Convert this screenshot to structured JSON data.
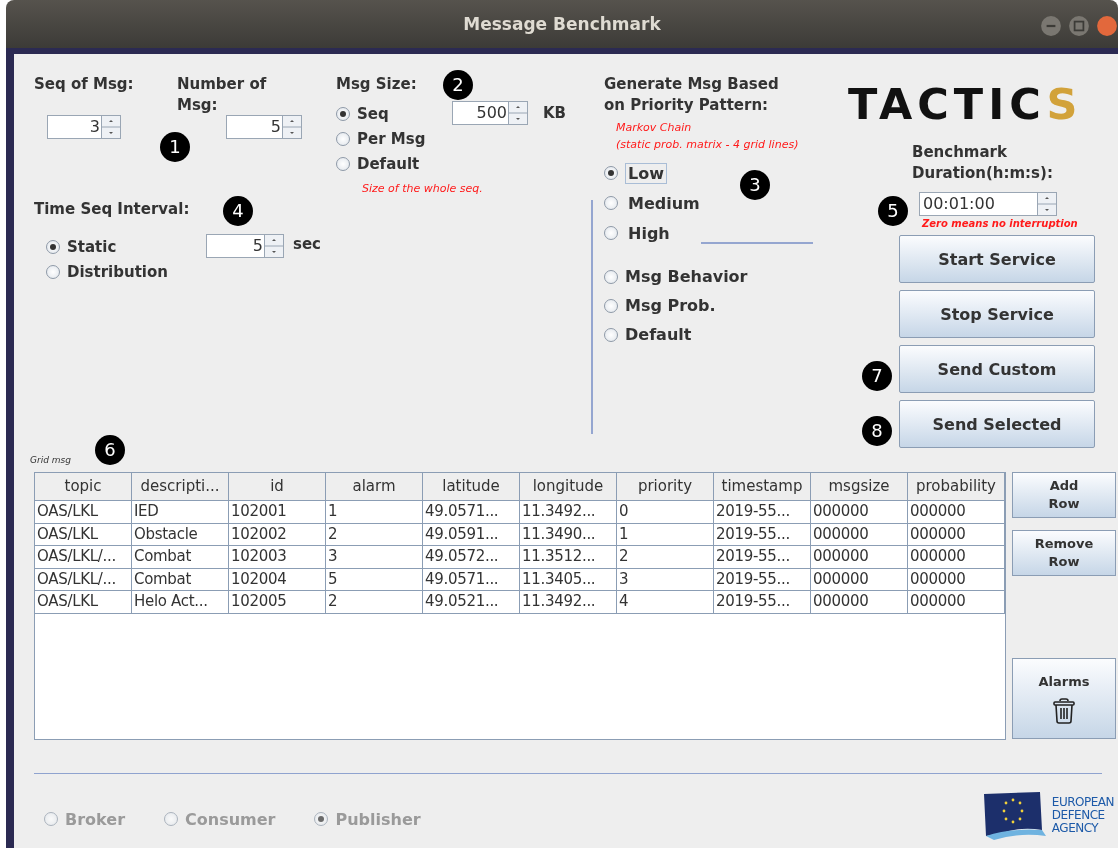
{
  "window": {
    "title": "Message Benchmark"
  },
  "seq_of_msg": {
    "label": "Seq of Msg:",
    "value": "3",
    "marker": "1"
  },
  "number_of_msg": {
    "label": "Number of Msg:",
    "value": "5"
  },
  "msg_size": {
    "label": "Msg Size:",
    "marker": "2",
    "value": "500",
    "unit": "KB",
    "note": "Size of the whole seq.",
    "options": [
      {
        "label": "Seq",
        "selected": true
      },
      {
        "label": "Per Msg",
        "selected": false
      },
      {
        "label": "Default",
        "selected": false
      }
    ]
  },
  "time_seq_interval": {
    "label": "Time Seq Interval:",
    "marker": "4",
    "value": "5",
    "unit": "sec",
    "options": [
      {
        "label": "Static",
        "selected": true
      },
      {
        "label": "Distribution",
        "selected": false
      }
    ]
  },
  "priority_pattern": {
    "label": "Generate Msg Based on Priority Pattern:",
    "note": [
      "Markov Chain",
      "(static prob. matrix - 4 grid lines)"
    ],
    "marker": "3",
    "levels": [
      {
        "label": "Low",
        "selected": true,
        "focused": true
      },
      {
        "label": "Medium",
        "selected": false,
        "focused": false
      },
      {
        "label": "High",
        "selected": false,
        "focused": false
      }
    ],
    "modes": [
      {
        "label": "Msg Behavior",
        "selected": false
      },
      {
        "label": "Msg Prob.",
        "selected": false
      },
      {
        "label": "Default",
        "selected": false
      }
    ]
  },
  "logo": {
    "text": "TACTIC",
    "accent": "S"
  },
  "benchmark_duration": {
    "label": "Benchmark Duration(h:m:s):",
    "marker": "5",
    "value": "00:01:00",
    "note": "Zero means no interruption"
  },
  "buttons": [
    {
      "label": "Start Service"
    },
    {
      "label": "Stop Service"
    },
    {
      "label": "Send Custom",
      "marker": "7"
    },
    {
      "label": "Send Selected",
      "marker": "8"
    }
  ],
  "grid": {
    "label": "Grid msg",
    "marker": "6",
    "columns": [
      "topic",
      "descripti...",
      "id",
      "alarm",
      "latitude",
      "longitude",
      "priority",
      "timestamp",
      "msgsize",
      "probability"
    ],
    "rows": [
      [
        "OAS/LKL",
        "IED",
        "102001",
        "1",
        "49.0571...",
        "11.3492...",
        "0",
        "2019-55...",
        "000000",
        "000000"
      ],
      [
        "OAS/LKL",
        "Obstacle",
        "102002",
        "2",
        "49.0591...",
        "11.3490...",
        "1",
        "2019-55...",
        "000000",
        "000000"
      ],
      [
        "OAS/LKL/...",
        "Combat",
        "102003",
        "3",
        "49.0572...",
        "11.3512...",
        "2",
        "2019-55...",
        "000000",
        "000000"
      ],
      [
        "OAS/LKL/...",
        "Combat",
        "102004",
        "5",
        "49.0571...",
        "11.3405...",
        "3",
        "2019-55...",
        "000000",
        "000000"
      ],
      [
        "OAS/LKL",
        "Helo Act...",
        "102005",
        "2",
        "49.0521...",
        "11.3492...",
        "4",
        "2019-55...",
        "000000",
        "000000"
      ]
    ]
  },
  "table_buttons": [
    {
      "kind": "text",
      "lines": [
        "Add",
        "Row"
      ]
    },
    {
      "kind": "text",
      "lines": [
        "Remove",
        "Row"
      ]
    },
    {
      "kind": "trash",
      "lines": [
        "Alarms"
      ]
    }
  ],
  "roles": [
    {
      "label": "Broker",
      "selected": false,
      "disabled": true
    },
    {
      "label": "Consumer",
      "selected": false,
      "disabled": true
    },
    {
      "label": "Publisher",
      "selected": true,
      "disabled": true
    }
  ],
  "agency_logo": {
    "lines": [
      "EUROPEAN",
      "DEFENCE",
      "AGENCY"
    ]
  }
}
